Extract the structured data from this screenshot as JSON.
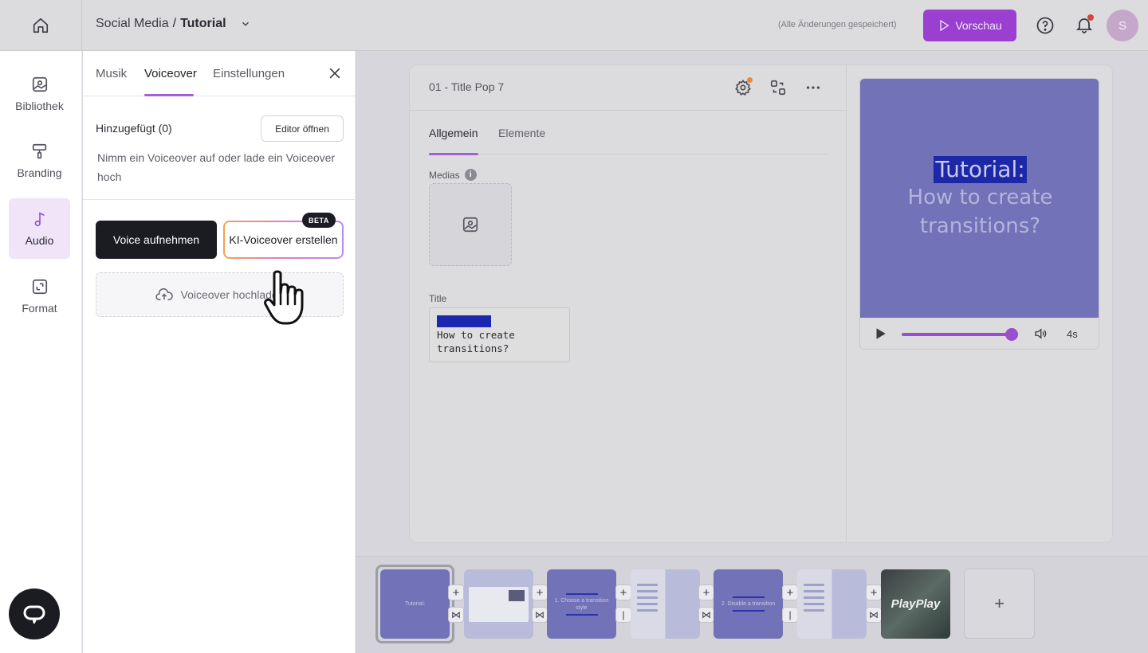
{
  "topbar": {
    "project": "Social Media",
    "separator": "/",
    "current": "Tutorial",
    "saved_status": "(Alle Änderungen gespeichert)",
    "preview_label": "Vorschau",
    "avatar_initial": "S",
    "accent_color": "#9a3fd0"
  },
  "rail": {
    "items": [
      {
        "label": "Bibliothek",
        "icon": "image-icon"
      },
      {
        "label": "Branding",
        "icon": "paint-roller-icon"
      },
      {
        "label": "Audio",
        "icon": "music-note-icon",
        "active": true
      },
      {
        "label": "Format",
        "icon": "resize-icon"
      }
    ]
  },
  "panel": {
    "tabs": [
      "Musik",
      "Voiceover",
      "Einstellungen"
    ],
    "active_tab": "Voiceover",
    "added_label": "Hinzugefügt (0)",
    "editor_button": "Editor öffnen",
    "hint": "Nimm ein Voiceover auf oder lade ein Voiceover hoch",
    "record_button": "Voice aufnehmen",
    "ai_button": "KI-Voiceover erstellen",
    "beta_badge": "BETA",
    "upload_label": "Voiceover hochladen"
  },
  "editor": {
    "slide_title": "01 - Title Pop 7",
    "subtabs": [
      "Allgemein",
      "Elemente"
    ],
    "active_subtab": "Allgemein",
    "medias_label": "Medias",
    "title_label": "Title",
    "title_value_line1": "Tutorial:",
    "title_value_line2": "How to create",
    "title_value_line3": "transitions?"
  },
  "preview": {
    "line1": "Tutorial:",
    "line2": "How to create",
    "line3": "transitions?",
    "duration": "4s",
    "progress": 1.0
  },
  "timeline": {
    "thumbs": [
      {
        "text": "Tutorial:"
      },
      {
        "text": ""
      },
      {
        "text": "1. Choose a transition style"
      },
      {
        "text": ""
      },
      {
        "text": "2. Disable a transition"
      },
      {
        "text": ""
      },
      {
        "text": "PlayPlay"
      }
    ],
    "add_symbol": "+",
    "transition_symbol_a": "⋈",
    "transition_symbol_b": "|"
  }
}
